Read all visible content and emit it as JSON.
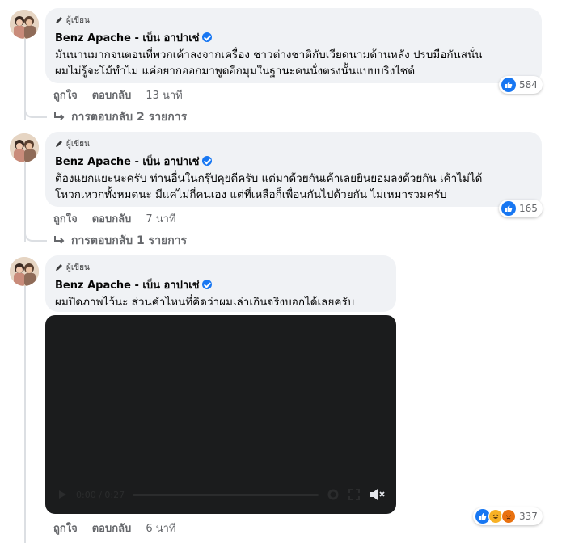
{
  "comments": [
    {
      "badge": "ผู้เขียน",
      "author": "Benz Apache - เบ็น อาปาเช่",
      "lines": [
        "มันนานมากจนตอนที่พวกเค้าลงจากเครื่อง ชาวต่างชาติกับเวียดนามด้านหลัง ปรบมือกันสนั่น",
        "ผมไม่รู้จะโม้ทำไม แค่อยากออกมาพูดอีกมุมในฐานะคนนั่งตรงนั้นแบบบริงไซด์"
      ],
      "like_label": "ถูกใจ",
      "reply_label": "ตอบกลับ",
      "time": "13 นาที",
      "reaction_count": "584",
      "replies_label": "การตอบกลับ 2 รายการ"
    },
    {
      "badge": "ผู้เขียน",
      "author": "Benz Apache - เบ็น อาปาเช่",
      "lines": [
        "ต้องแยกแยะนะครับ ท่านอื่นในกรุ๊ปคุยดีครับ แต่มาด้วยกันเค้าเลยยินยอมลงด้วยกัน เค้าไม่ได้",
        "โหวกเหวกทั้งหมดนะ มีแค่ไม่กี่คนเอง แต่ที่เหลือก็เพื่อนกันไปด้วยกัน ไม่เหมารวมครับ"
      ],
      "like_label": "ถูกใจ",
      "reply_label": "ตอบกลับ",
      "time": "7 นาที",
      "reaction_count": "165",
      "replies_label": "การตอบกลับ 1 รายการ"
    },
    {
      "badge": "ผู้เขียน",
      "author": "Benz Apache - เบ็น อาปาเช่",
      "lines": [
        "ผมปิดภาพไว้นะ ส่วนคำไหนที่คิดว่าผมเล่าเกินจริงบอกได้เลยครับ"
      ],
      "like_label": "ถูกใจ",
      "reply_label": "ตอบกลับ",
      "time": "6 นาที",
      "reaction_count": "337"
    }
  ],
  "video": {
    "time_display": "0:00 / 0:27"
  },
  "colors": {
    "accent": "#1877f2",
    "bubble": "#f0f2f5",
    "muted": "#65676b"
  },
  "icons": [
    "pencil-icon",
    "verified-badge-icon",
    "reply-arrow-icon",
    "like-reaction-icon",
    "haha-reaction-icon",
    "angry-reaction-icon",
    "play-icon",
    "gear-icon",
    "fullscreen-icon",
    "mute-icon"
  ]
}
